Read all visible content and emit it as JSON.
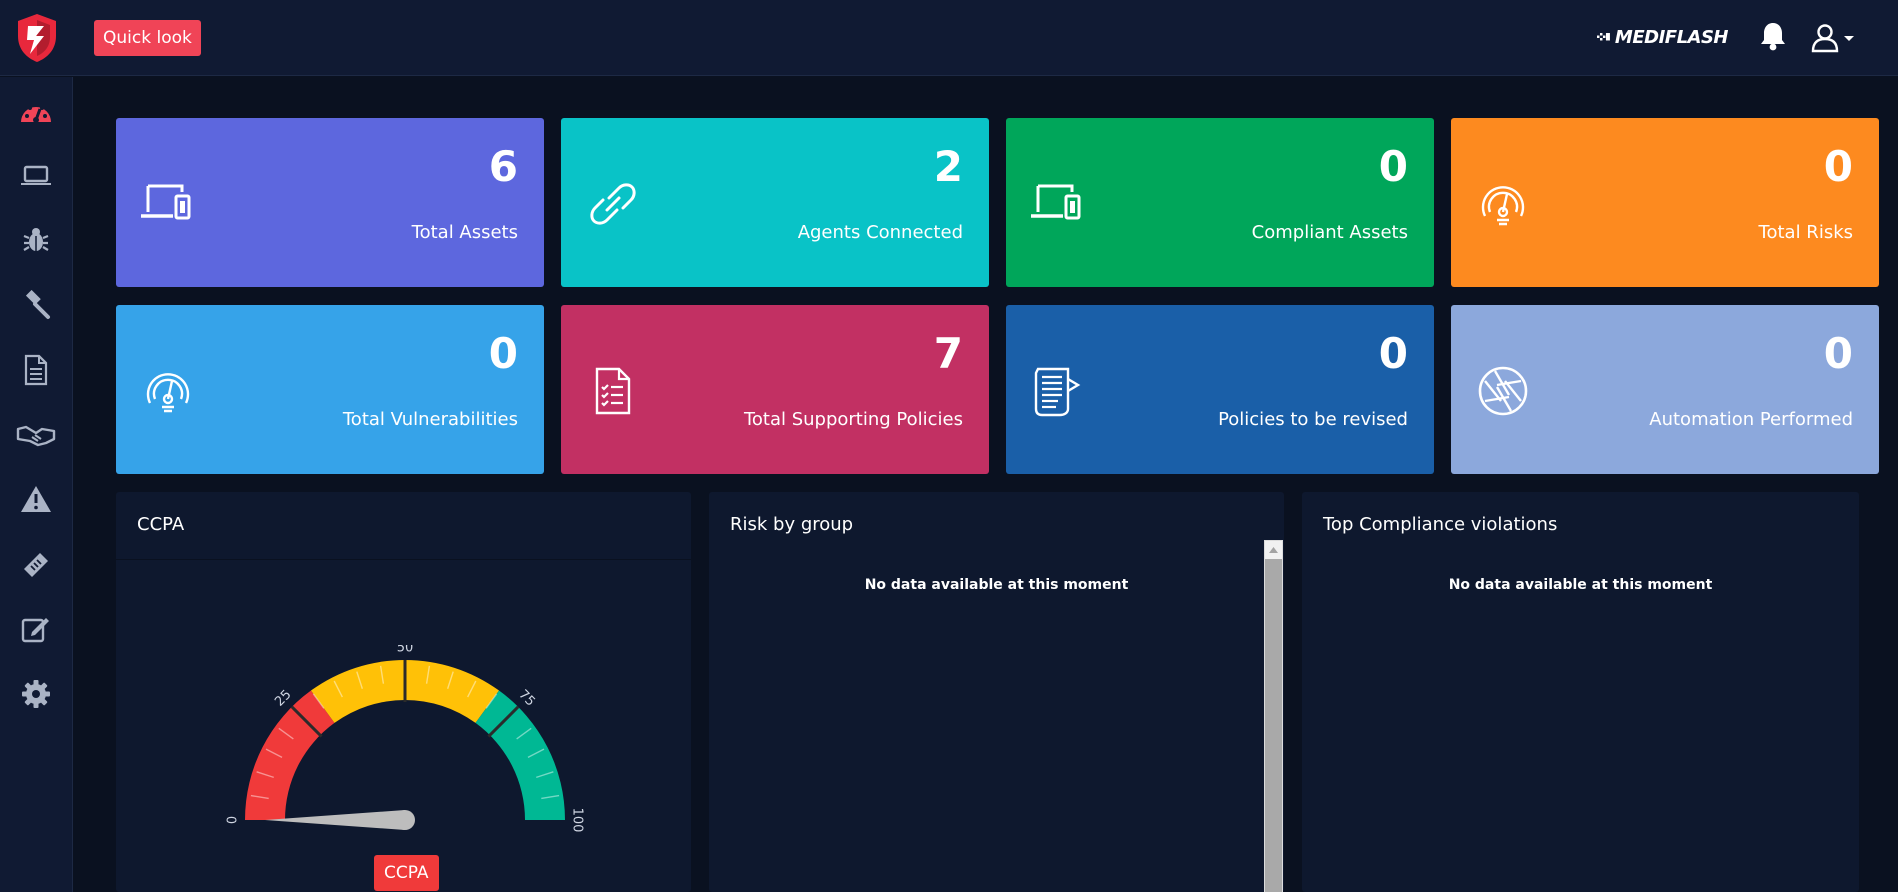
{
  "header": {
    "quick_look_label": "Quick look",
    "brand": "MEDIFLASH",
    "icons": {
      "logo": "app-logo-shield",
      "bell": "bell-icon",
      "user": "user-icon",
      "caret": "caret-down-icon"
    }
  },
  "sidebar": {
    "items": [
      {
        "name": "dashboard",
        "icon": "speedometer-icon",
        "active": true
      },
      {
        "name": "assets",
        "icon": "laptop-icon"
      },
      {
        "name": "vulnerabilities",
        "icon": "bug-icon"
      },
      {
        "name": "compliance",
        "icon": "gavel-icon"
      },
      {
        "name": "policies",
        "icon": "document-icon"
      },
      {
        "name": "vendors",
        "icon": "handshake-icon"
      },
      {
        "name": "risks",
        "icon": "warning-icon"
      },
      {
        "name": "tickets",
        "icon": "ticket-icon"
      },
      {
        "name": "assessments",
        "icon": "edit-icon"
      },
      {
        "name": "settings",
        "icon": "gear-icon"
      }
    ],
    "active_color": "#f04457",
    "icon_color": "#aab3c5"
  },
  "cards": [
    {
      "value": "6",
      "label": "Total Assets",
      "color": "#5d67de",
      "icon": "devices-icon"
    },
    {
      "value": "2",
      "label": "Agents Connected",
      "color": "#09c3c7",
      "icon": "link-icon"
    },
    {
      "value": "0",
      "label": "Compliant Assets",
      "color": "#00a65a",
      "icon": "devices-icon"
    },
    {
      "value": "0",
      "label": "Total Risks",
      "color": "#fd8a1f",
      "icon": "gauge-icon"
    },
    {
      "value": "0",
      "label": "Total Vulnerabilities",
      "color": "#36a3e9",
      "icon": "gauge-icon"
    },
    {
      "value": "7",
      "label": "Total Supporting Policies",
      "color": "#c23063",
      "icon": "checklist-icon"
    },
    {
      "value": "0",
      "label": "Policies to be revised",
      "color": "#1a5fa8",
      "icon": "policy-doc-icon"
    },
    {
      "value": "0",
      "label": "Automation Performed",
      "color": "#8ca8dc",
      "icon": "aperture-icon"
    }
  ],
  "panels": {
    "ccpa": {
      "title": "CCPA",
      "gauge": {
        "value": 0,
        "min": 0,
        "max": 100,
        "ticks": [
          "0",
          "25",
          "50",
          "75",
          "100"
        ],
        "bands": [
          {
            "from": 0,
            "to": 30,
            "color": "#f03a3a"
          },
          {
            "from": 30,
            "to": 70,
            "color": "#ffc107"
          },
          {
            "from": 70,
            "to": 100,
            "color": "#00b894"
          }
        ],
        "label": "CCPA"
      }
    },
    "risk_by_group": {
      "title": "Risk by group",
      "message": "No data available at this moment"
    },
    "top_compliance": {
      "title": "Top Compliance violations",
      "message": "No data available at this moment"
    }
  }
}
